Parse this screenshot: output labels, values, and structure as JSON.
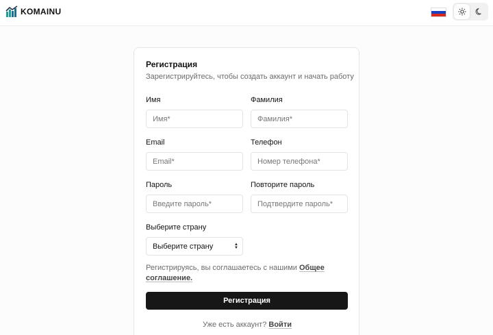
{
  "header": {
    "logo_text": "KOMAINU",
    "flag_colors": [
      "#ffffff",
      "#1a3fbf",
      "#d52b1e"
    ],
    "theme_icons": [
      "sun-icon",
      "moon-icon"
    ]
  },
  "form": {
    "title": "Регистрация",
    "subtitle": "Зарегистрируйтесь, чтобы создать аккаунт и начать работу",
    "first_name": {
      "label": "Имя",
      "placeholder": "Имя*"
    },
    "last_name": {
      "label": "Фамилия",
      "placeholder": "Фамилия*"
    },
    "email": {
      "label": "Email",
      "placeholder": "Email*"
    },
    "phone": {
      "label": "Телефон",
      "placeholder": "Номер телефона*"
    },
    "password": {
      "label": "Пароль",
      "placeholder": "Введите пароль*"
    },
    "password_repeat": {
      "label": "Повторите пароль",
      "placeholder": "Подтвердите пароль*"
    },
    "country": {
      "label": "Выберите страну",
      "selected": "Выберите страну"
    },
    "agreement_text": "Регистрируясь, вы соглашаетесь с нашими",
    "agreement_link": "Общее соглашение.",
    "submit_label": "Регистрация",
    "login_prompt": "Уже есть аккаунт?",
    "login_link": "Войти"
  }
}
